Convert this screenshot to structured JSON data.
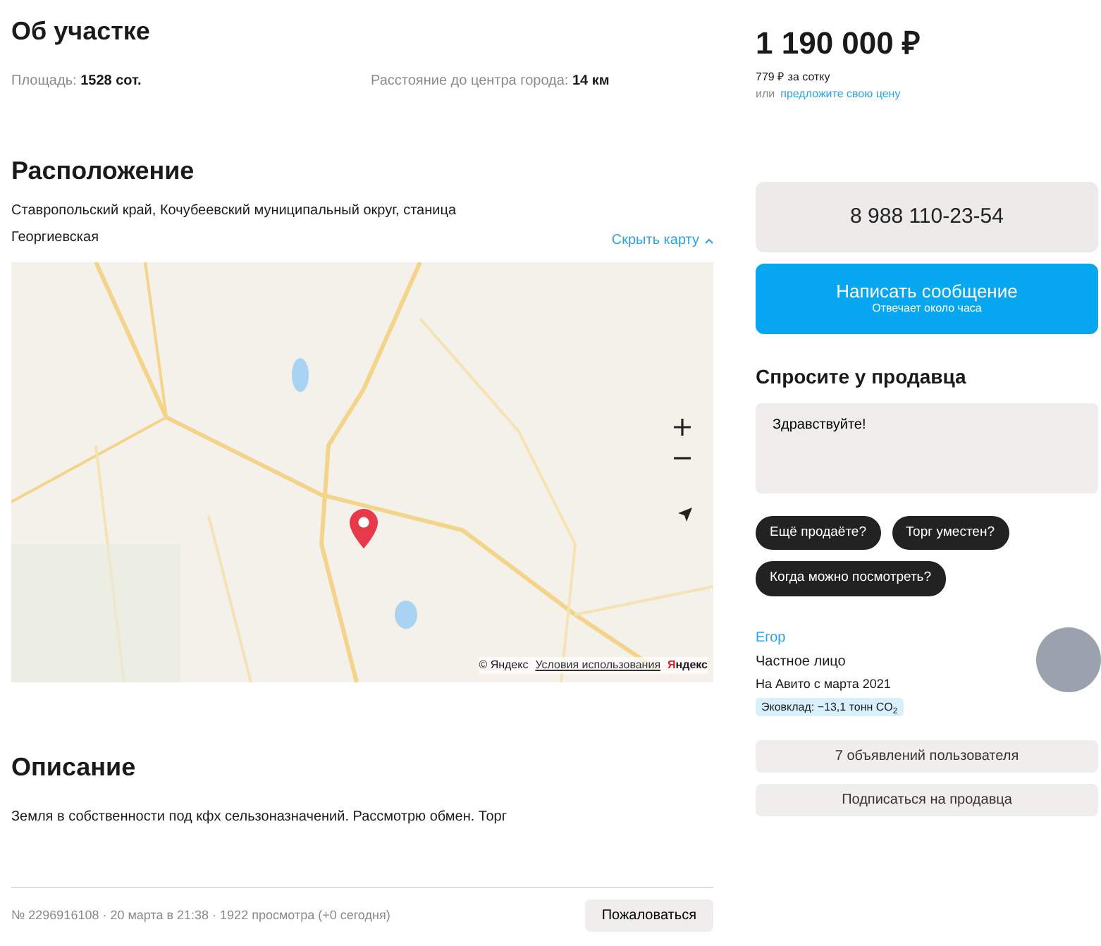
{
  "about": {
    "title": "Об участке",
    "params": [
      {
        "label": "Площадь:",
        "value": "1528 сот."
      },
      {
        "label": "Расстояние до центра города:",
        "value": "14 км"
      }
    ]
  },
  "location": {
    "title": "Расположение",
    "address": "Ставропольский край, Кочубеевский муниципальный округ, станица Георгиевская",
    "toggle": "Скрыть карту",
    "map": {
      "attribution": "© Яндекс",
      "terms": "Условия использования",
      "logo": "Яндекс"
    }
  },
  "description": {
    "title": "Описание",
    "text": "Земля в собственности под кфх сельзоназначений. Рассмотрю обмен. Торг"
  },
  "footer": {
    "meta": "№ 2296916108 · 20 марта в 21:38 · 1922 просмотра (+0 сегодня)",
    "report": "Пожаловаться"
  },
  "price": {
    "amount": "1 190 000 ₽",
    "per_unit": "779 ₽ за сотку",
    "offer_prefix": "или",
    "offer_link": "предложите свою цену"
  },
  "contact": {
    "phone": "8 988 110-23-54",
    "message": {
      "label": "Написать сообщение",
      "note": "Отвечает около часа"
    }
  },
  "ask": {
    "title": "Спросите у продавца",
    "value": "Здравствуйте!",
    "chips": [
      "Ещё продаёте?",
      "Торг уместен?",
      "Когда можно посмотреть?"
    ]
  },
  "seller": {
    "name": "Егор",
    "type": "Частное лицо",
    "since": "На Авито с марта 2021",
    "eco": "Эковклад: −13,1 тонн CO$_{2}$",
    "buttons": [
      "7 объявлений пользователя",
      "Подписаться на продавца"
    ]
  }
}
